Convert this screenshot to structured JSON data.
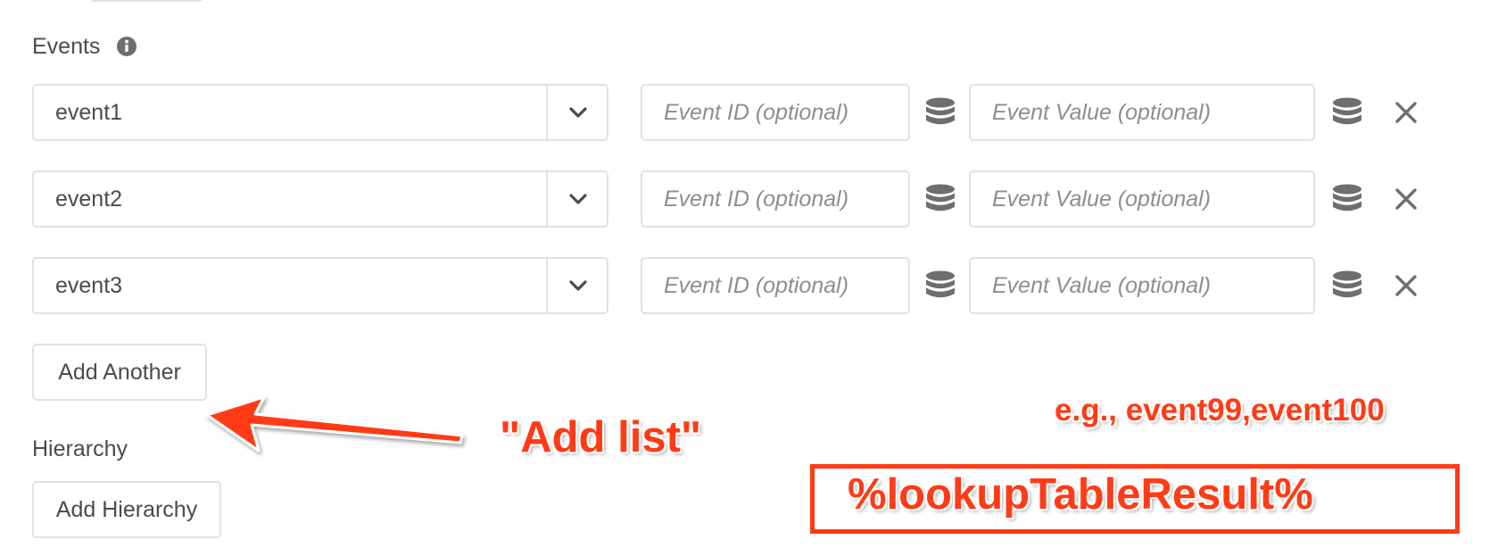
{
  "events_section": {
    "label": "Events",
    "rows": [
      {
        "event": "event1",
        "event_id_value": "",
        "event_id_placeholder": "Event ID (optional)",
        "event_value_value": "",
        "event_value_placeholder": "Event Value (optional)"
      },
      {
        "event": "event2",
        "event_id_value": "",
        "event_id_placeholder": "Event ID (optional)",
        "event_value_value": "",
        "event_value_placeholder": "Event Value (optional)"
      },
      {
        "event": "event3",
        "event_id_value": "",
        "event_id_placeholder": "Event ID (optional)",
        "event_value_value": "",
        "event_value_placeholder": "Event Value (optional)"
      }
    ],
    "add_button_label": "Add Another"
  },
  "hierarchy_section": {
    "label": "Hierarchy",
    "add_button_label": "Add Hierarchy"
  },
  "annotations": {
    "arrow_label": "\"Add list\"",
    "example_text": "e.g., event99,event100",
    "box_text": "%lookupTableResult%",
    "color": "#ff3b16"
  },
  "icons": {
    "info": "info-icon",
    "dropdown": "chevron-down-icon",
    "data_element": "database-icon",
    "remove": "close-icon"
  }
}
